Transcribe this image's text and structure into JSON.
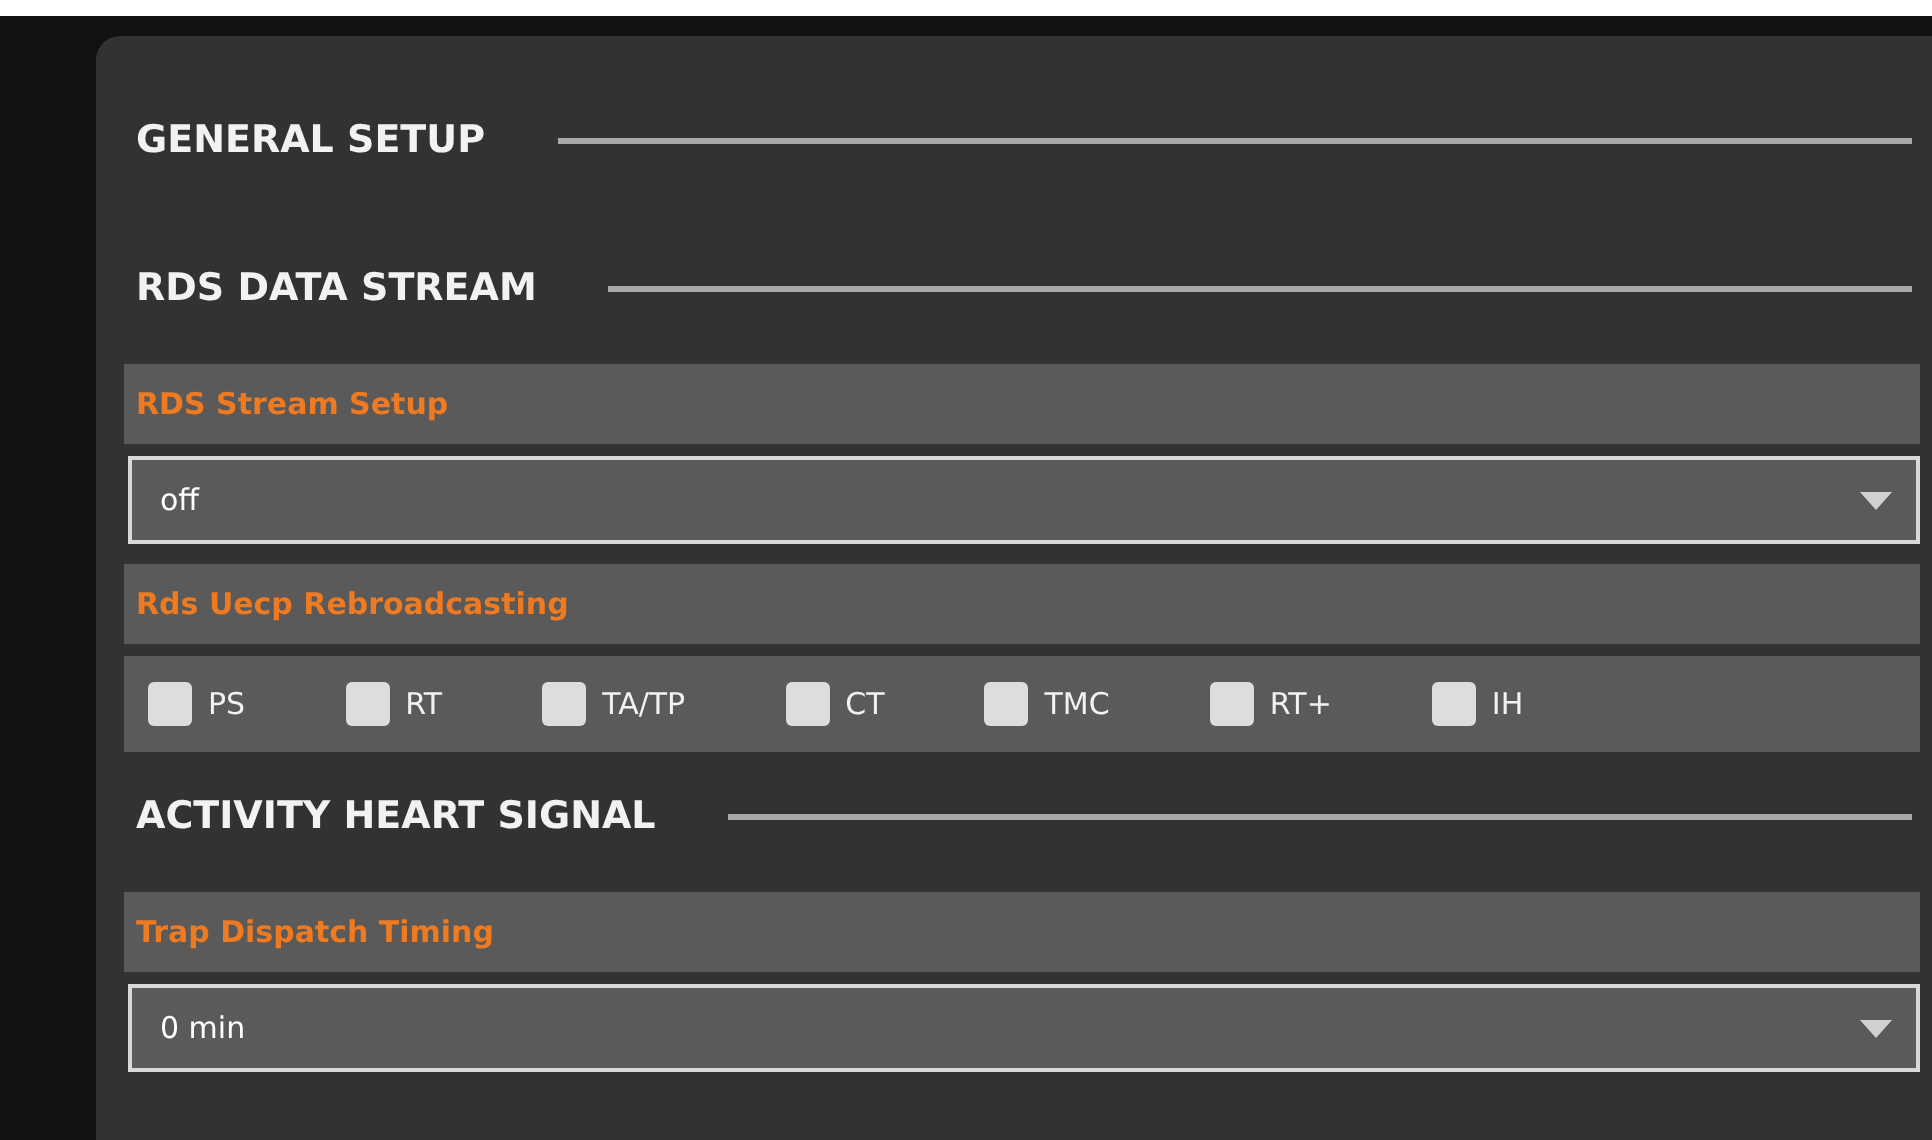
{
  "sections": [
    {
      "heading": "GENERAL SETUP"
    },
    {
      "heading": "RDS DATA STREAM",
      "fields": [
        {
          "kind": "select",
          "label": "RDS Stream Setup",
          "value": "off"
        },
        {
          "kind": "checkboxes",
          "label": "Rds Uecp Rebroadcasting",
          "options": [
            {
              "label": "PS",
              "checked": false
            },
            {
              "label": "RT",
              "checked": false
            },
            {
              "label": "TA/TP",
              "checked": false
            },
            {
              "label": "CT",
              "checked": false
            },
            {
              "label": "TMC",
              "checked": false
            },
            {
              "label": "RT+",
              "checked": false
            },
            {
              "label": "IH",
              "checked": false
            }
          ]
        }
      ]
    },
    {
      "heading": "ACTIVITY HEART SIGNAL",
      "fields": [
        {
          "kind": "select",
          "label": "Trap Dispatch Timing",
          "value": "0 min"
        }
      ]
    }
  ]
}
